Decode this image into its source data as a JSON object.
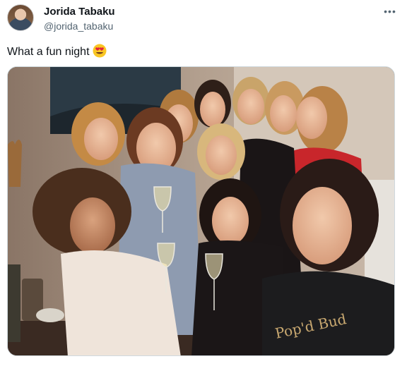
{
  "tweet": {
    "author": {
      "display_name": "Jorida Tabaku",
      "handle": "@jorida_tabaku",
      "avatar_icon": "profile-photo"
    },
    "more_label": "•••",
    "text": "What a fun night",
    "emoji_icon": "heart-eyes-emoji",
    "photo": {
      "shirt_text": "Pop'd Bud"
    }
  }
}
